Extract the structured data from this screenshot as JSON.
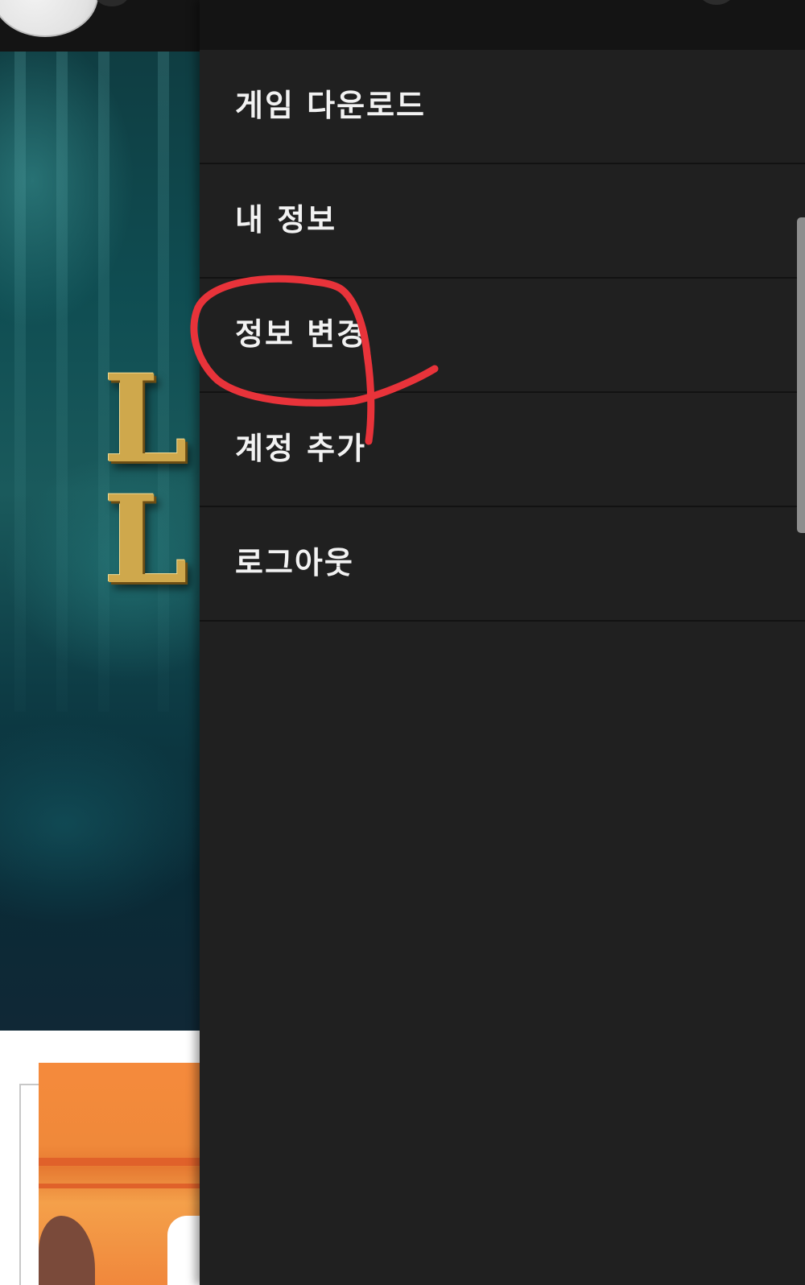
{
  "hero": {
    "logo_line1": "L",
    "logo_line2": "L"
  },
  "drawer": {
    "menu_items": [
      {
        "label": "게임 다운로드"
      },
      {
        "label": "내 정보"
      },
      {
        "label": "정보 변경"
      },
      {
        "label": "계정 추가"
      },
      {
        "label": "로그아웃"
      }
    ]
  },
  "annotation": {
    "color": "#e8333a",
    "target": "정보 변경"
  },
  "colors": {
    "drawer_background": "#202020",
    "drawer_header": "#141414",
    "menu_text": "#f2f2f2",
    "divider": "#121212",
    "hero_gold": "#cfa84c",
    "promo_orange": "#f0893a"
  },
  "icons": {
    "avatar": "avatar",
    "scrollbar": "scroll-indicator"
  }
}
